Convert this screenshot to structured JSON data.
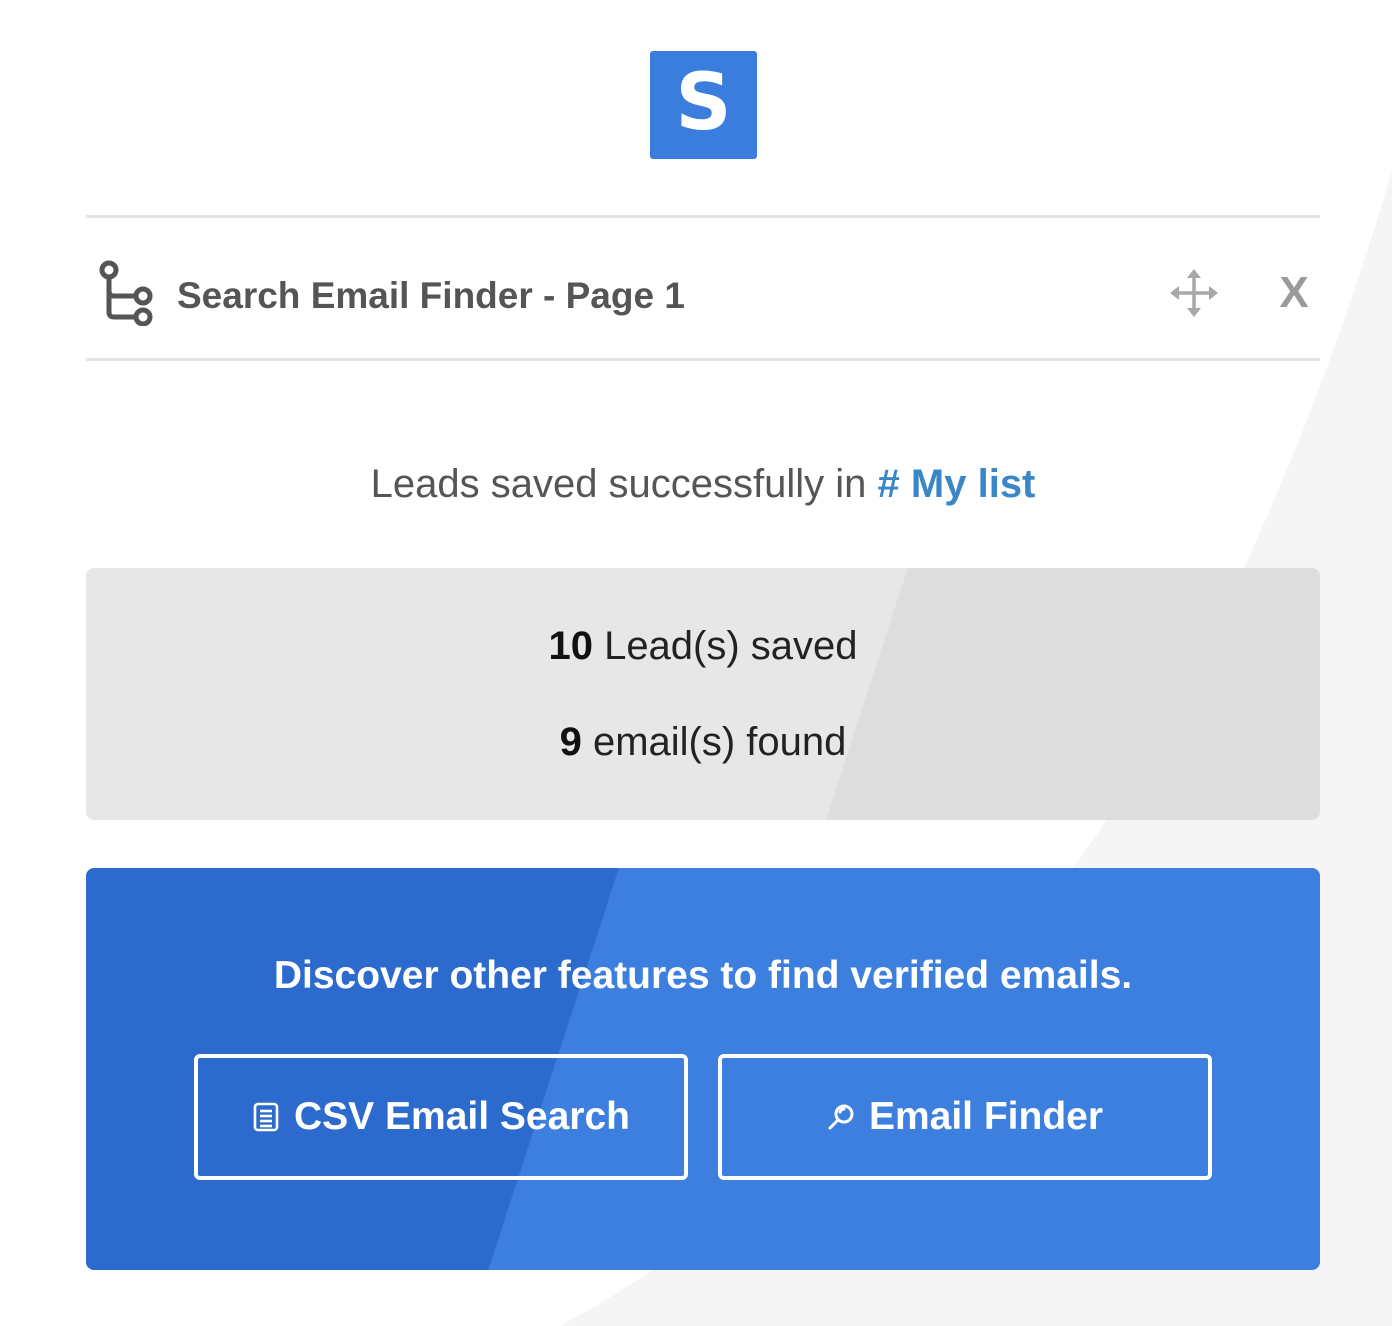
{
  "logo": {
    "letter": "S",
    "color": "#3b7ddd"
  },
  "header": {
    "icon": "flow-branch-icon",
    "title": "Search Email Finder - Page 1",
    "move_icon": "move-arrows-icon",
    "close_label": "X"
  },
  "message": {
    "prefix": "Leads saved successfully in ",
    "list_name": "# My list"
  },
  "stats": {
    "leads_count": "10",
    "leads_label": " Lead(s) saved",
    "emails_count": "9",
    "emails_label": " email(s) found"
  },
  "promo": {
    "title": "Discover other features to find verified emails.",
    "buttons": [
      {
        "label": "CSV Email Search",
        "icon": "document-list-icon"
      },
      {
        "label": "Email Finder",
        "icon": "magnifier-icon"
      }
    ],
    "color_dark": "#2c6bcd",
    "color_light": "#3c7fdf"
  },
  "colors": {
    "accent": "#3b7ddd",
    "link": "#3a87c8",
    "text": "#555555"
  }
}
